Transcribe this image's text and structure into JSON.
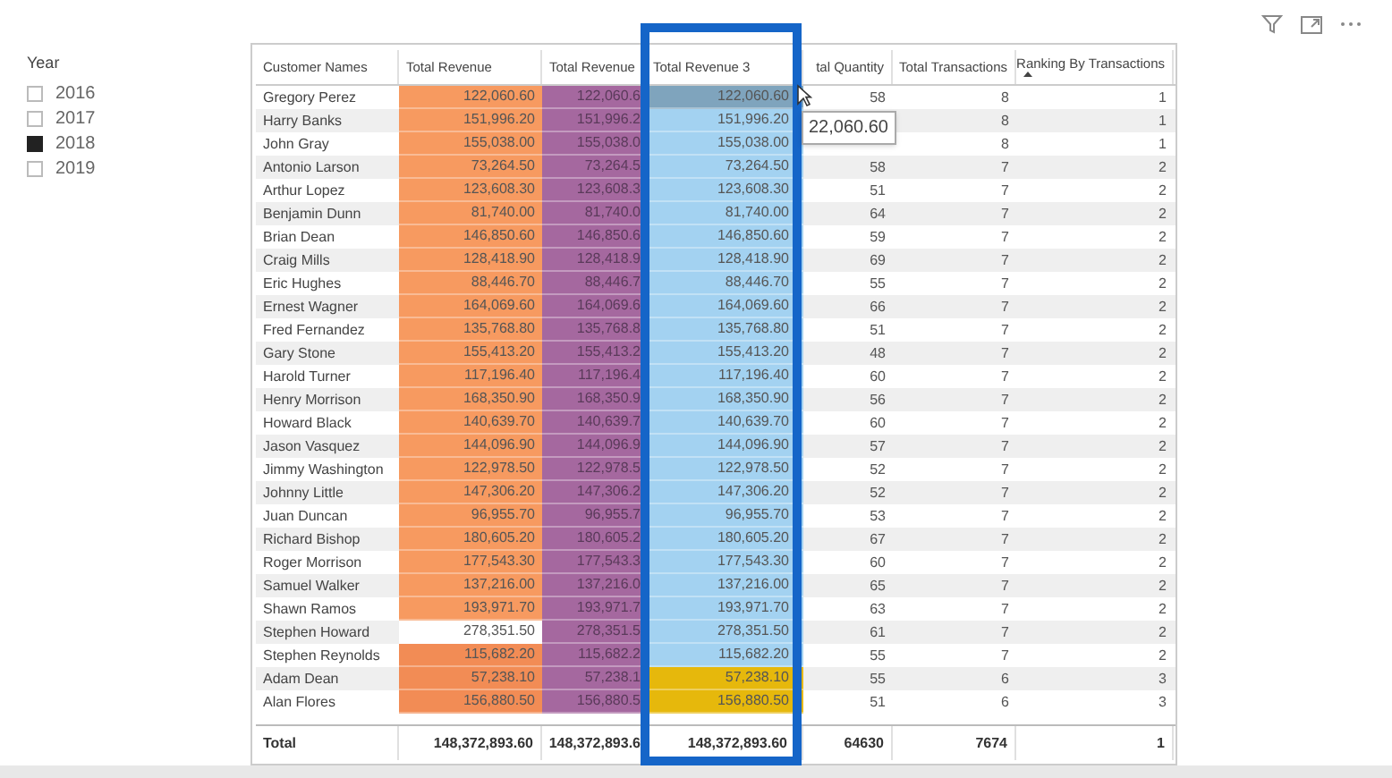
{
  "slicer": {
    "title": "Year",
    "items": [
      {
        "label": "2016",
        "checked": false
      },
      {
        "label": "2017",
        "checked": false
      },
      {
        "label": "2018",
        "checked": true
      },
      {
        "label": "2019",
        "checked": false
      }
    ]
  },
  "table": {
    "columns": [
      "Customer Names",
      "Total Revenue",
      "Total Revenue",
      "Total Revenue 3",
      "tal Quantity",
      "Total Transactions",
      "Ranking By Transactions"
    ],
    "rows": [
      {
        "name": "Gregory Perez",
        "revenue": {
          "text": "122,060.60",
          "color": "#f79a60"
        },
        "revenue2": "122,060.6",
        "revenue3": {
          "text": "122,060.60",
          "color": "#7fa4bd"
        },
        "quantity": "58",
        "transactions": "8",
        "ranking": "1"
      },
      {
        "name": "Harry Banks",
        "revenue": {
          "text": "151,996.20",
          "color": "#f79a60"
        },
        "revenue2": "151,996.2",
        "revenue3": {
          "text": "151,996.20",
          "color": "#a3d2f1"
        },
        "transactions": "8",
        "ranking": "1"
      },
      {
        "name": "John Gray",
        "revenue": {
          "text": "155,038.00",
          "color": "#f79a60"
        },
        "revenue2": "155,038.0",
        "revenue3": {
          "text": "155,038.00",
          "color": "#a3d2f1"
        },
        "transactions": "8",
        "ranking": "1"
      },
      {
        "name": "Antonio Larson",
        "revenue": {
          "text": "73,264.50",
          "color": "#f79a60"
        },
        "revenue2": "73,264.5",
        "revenue3": {
          "text": "73,264.50",
          "color": "#a3d2f1"
        },
        "quantity": "58",
        "transactions": "7",
        "ranking": "2"
      },
      {
        "name": "Arthur Lopez",
        "revenue": {
          "text": "123,608.30",
          "color": "#f79a60"
        },
        "revenue2": "123,608.3",
        "revenue3": {
          "text": "123,608.30",
          "color": "#a3d2f1"
        },
        "quantity": "51",
        "transactions": "7",
        "ranking": "2"
      },
      {
        "name": "Benjamin Dunn",
        "revenue": {
          "text": "81,740.00",
          "color": "#f79a60"
        },
        "revenue2": "81,740.0",
        "revenue3": {
          "text": "81,740.00",
          "color": "#a3d2f1"
        },
        "quantity": "64",
        "transactions": "7",
        "ranking": "2"
      },
      {
        "name": "Brian Dean",
        "revenue": {
          "text": "146,850.60",
          "color": "#f79a60"
        },
        "revenue2": "146,850.6",
        "revenue3": {
          "text": "146,850.60",
          "color": "#a3d2f1"
        },
        "quantity": "59",
        "transactions": "7",
        "ranking": "2"
      },
      {
        "name": "Craig Mills",
        "revenue": {
          "text": "128,418.90",
          "color": "#f79a60"
        },
        "revenue2": "128,418.9",
        "revenue3": {
          "text": "128,418.90",
          "color": "#a3d2f1"
        },
        "quantity": "69",
        "transactions": "7",
        "ranking": "2"
      },
      {
        "name": "Eric Hughes",
        "revenue": {
          "text": "88,446.70",
          "color": "#f79a60"
        },
        "revenue2": "88,446.7",
        "revenue3": {
          "text": "88,446.70",
          "color": "#a3d2f1"
        },
        "quantity": "55",
        "transactions": "7",
        "ranking": "2"
      },
      {
        "name": "Ernest Wagner",
        "revenue": {
          "text": "164,069.60",
          "color": "#f79a60"
        },
        "revenue2": "164,069.6",
        "revenue3": {
          "text": "164,069.60",
          "color": "#a3d2f1"
        },
        "quantity": "66",
        "transactions": "7",
        "ranking": "2"
      },
      {
        "name": "Fred Fernandez",
        "revenue": {
          "text": "135,768.80",
          "color": "#f79a60"
        },
        "revenue2": "135,768.8",
        "revenue3": {
          "text": "135,768.80",
          "color": "#a3d2f1"
        },
        "quantity": "51",
        "transactions": "7",
        "ranking": "2"
      },
      {
        "name": "Gary Stone",
        "revenue": {
          "text": "155,413.20",
          "color": "#f79a60"
        },
        "revenue2": "155,413.2",
        "revenue3": {
          "text": "155,413.20",
          "color": "#a3d2f1"
        },
        "quantity": "48",
        "transactions": "7",
        "ranking": "2"
      },
      {
        "name": "Harold Turner",
        "revenue": {
          "text": "117,196.40",
          "color": "#f79a60"
        },
        "revenue2": "117,196.4",
        "revenue3": {
          "text": "117,196.40",
          "color": "#a3d2f1"
        },
        "quantity": "60",
        "transactions": "7",
        "ranking": "2"
      },
      {
        "name": "Henry Morrison",
        "revenue": {
          "text": "168,350.90",
          "color": "#f79a60"
        },
        "revenue2": "168,350.9",
        "revenue3": {
          "text": "168,350.90",
          "color": "#a3d2f1"
        },
        "quantity": "56",
        "transactions": "7",
        "ranking": "2"
      },
      {
        "name": "Howard Black",
        "revenue": {
          "text": "140,639.70",
          "color": "#f79a60"
        },
        "revenue2": "140,639.7",
        "revenue3": {
          "text": "140,639.70",
          "color": "#a3d2f1"
        },
        "quantity": "60",
        "transactions": "7",
        "ranking": "2"
      },
      {
        "name": "Jason Vasquez",
        "revenue": {
          "text": "144,096.90",
          "color": "#f79a60"
        },
        "revenue2": "144,096.9",
        "revenue3": {
          "text": "144,096.90",
          "color": "#a3d2f1"
        },
        "quantity": "57",
        "transactions": "7",
        "ranking": "2"
      },
      {
        "name": "Jimmy Washington",
        "revenue": {
          "text": "122,978.50",
          "color": "#f79a60"
        },
        "revenue2": "122,978.5",
        "revenue3": {
          "text": "122,978.50",
          "color": "#a3d2f1"
        },
        "quantity": "52",
        "transactions": "7",
        "ranking": "2"
      },
      {
        "name": "Johnny Little",
        "revenue": {
          "text": "147,306.20",
          "color": "#f79a60"
        },
        "revenue2": "147,306.2",
        "revenue3": {
          "text": "147,306.20",
          "color": "#a3d2f1"
        },
        "quantity": "52",
        "transactions": "7",
        "ranking": "2"
      },
      {
        "name": "Juan Duncan",
        "revenue": {
          "text": "96,955.70",
          "color": "#f79a60"
        },
        "revenue2": "96,955.7",
        "revenue3": {
          "text": "96,955.70",
          "color": "#a3d2f1"
        },
        "quantity": "53",
        "transactions": "7",
        "ranking": "2"
      },
      {
        "name": "Richard Bishop",
        "revenue": {
          "text": "180,605.20",
          "color": "#f79a60"
        },
        "revenue2": "180,605.2",
        "revenue3": {
          "text": "180,605.20",
          "color": "#a3d2f1"
        },
        "quantity": "67",
        "transactions": "7",
        "ranking": "2"
      },
      {
        "name": "Roger Morrison",
        "revenue": {
          "text": "177,543.30",
          "color": "#f79a60"
        },
        "revenue2": "177,543.3",
        "revenue3": {
          "text": "177,543.30",
          "color": "#a3d2f1"
        },
        "quantity": "60",
        "transactions": "7",
        "ranking": "2"
      },
      {
        "name": "Samuel Walker",
        "revenue": {
          "text": "137,216.00",
          "color": "#f79a60"
        },
        "revenue2": "137,216.0",
        "revenue3": {
          "text": "137,216.00",
          "color": "#a3d2f1"
        },
        "quantity": "65",
        "transactions": "7",
        "ranking": "2"
      },
      {
        "name": "Shawn Ramos",
        "revenue": {
          "text": "193,971.70",
          "color": "#f79a60"
        },
        "revenue2": "193,971.7",
        "revenue3": {
          "text": "193,971.70",
          "color": "#a3d2f1"
        },
        "quantity": "63",
        "transactions": "7",
        "ranking": "2"
      },
      {
        "name": "Stephen Howard",
        "revenue": {
          "text": "278,351.50",
          "color": "#ffffff"
        },
        "revenue2": "278,351.5",
        "revenue3": {
          "text": "278,351.50",
          "color": "#a3d2f1"
        },
        "quantity": "61",
        "transactions": "7",
        "ranking": "2"
      },
      {
        "name": "Stephen Reynolds",
        "revenue": {
          "text": "115,682.20",
          "color": "#f28c55"
        },
        "revenue2": "115,682.2",
        "revenue3": {
          "text": "115,682.20",
          "color": "#a3d2f1"
        },
        "quantity": "55",
        "transactions": "7",
        "ranking": "2"
      },
      {
        "name": "Adam Dean",
        "revenue": {
          "text": "57,238.10",
          "color": "#f28c55"
        },
        "revenue2": "57,238.1",
        "revenue3": {
          "text": "57,238.10",
          "color": "#e6b80c"
        },
        "quantity": "55",
        "transactions": "6",
        "ranking": "3"
      },
      {
        "name": "Alan Flores",
        "revenue": {
          "text": "156,880.50",
          "color": "#f28c55"
        },
        "revenue2": "156,880.5",
        "revenue3": {
          "text": "156,880.50",
          "color": "#e6b80c"
        },
        "quantity": "51",
        "transactions": "6",
        "ranking": "3"
      }
    ],
    "total": {
      "label": "Total",
      "revenue": "148,372,893.60",
      "revenue2": "148,372,893.6",
      "revenue3": "148,372,893.60",
      "quantity": "64630",
      "transactions": "7674",
      "ranking": "1"
    },
    "tooltip": {
      "text": "22,060.60"
    }
  }
}
